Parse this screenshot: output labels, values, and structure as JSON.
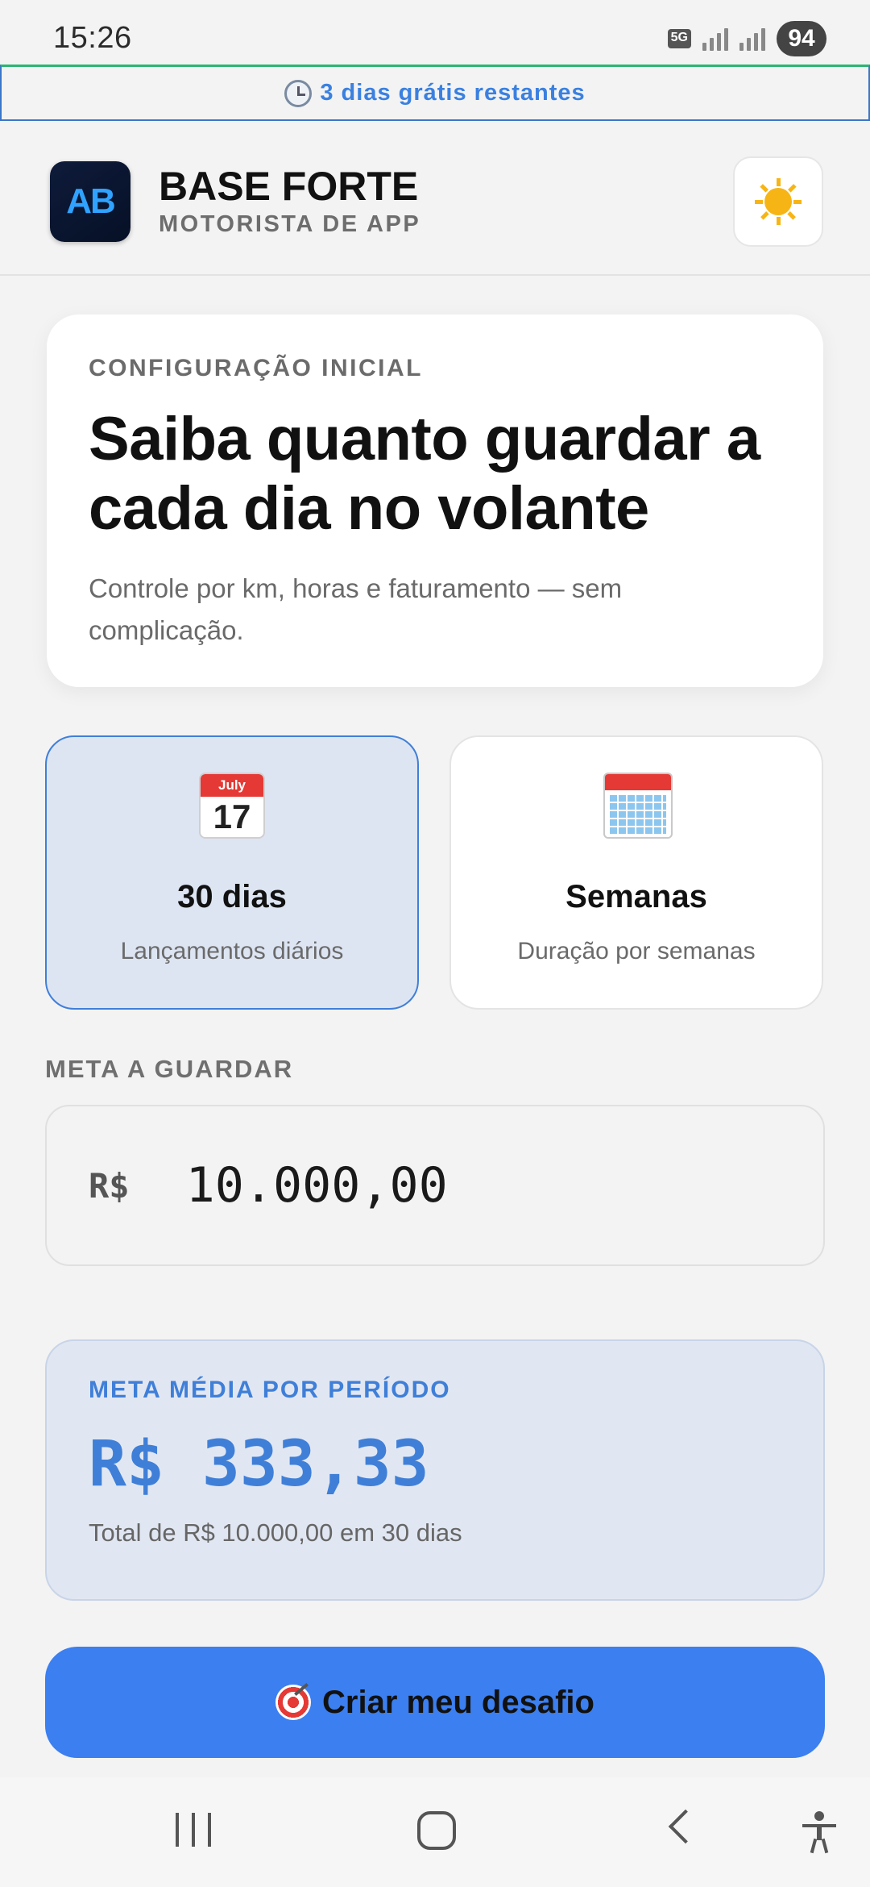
{
  "status_bar": {
    "time": "15:26",
    "network": "5G",
    "battery": "94"
  },
  "trial_banner": {
    "icon": "clock-icon",
    "text": "3 dias grátis restantes"
  },
  "header": {
    "logo_text": "AB",
    "title": "BASE FORTE",
    "subtitle": "MOTORISTA DE APP",
    "theme_icon": "sun-icon"
  },
  "intro": {
    "eyebrow": "CONFIGURAÇÃO INICIAL",
    "headline": "Saiba quanto guardar a cada dia no volante",
    "description": "Controle por km, horas e faturamento — sem complicação."
  },
  "modes": [
    {
      "icon": "calendar-day-icon",
      "calendar_month": "July",
      "calendar_day": "17",
      "label": "30 dias",
      "sublabel": "Lançamentos diários",
      "selected": true
    },
    {
      "icon": "calendar-grid-icon",
      "label": "Semanas",
      "sublabel": "Duração por semanas",
      "selected": false
    }
  ],
  "goal": {
    "label": "META A GUARDAR",
    "currency": "R$",
    "value": "10.000,00"
  },
  "summary": {
    "title": "META MÉDIA POR PERÍODO",
    "value": "R$ 333,33",
    "note": "Total de R$ 10.000,00 em 30 dias"
  },
  "cta": {
    "icon": "target-icon",
    "label": "Criar meu desafio"
  },
  "colors": {
    "accent": "#3b7ff0",
    "selected_bg": "#dde5f3",
    "trial_text": "#3a80e0"
  }
}
